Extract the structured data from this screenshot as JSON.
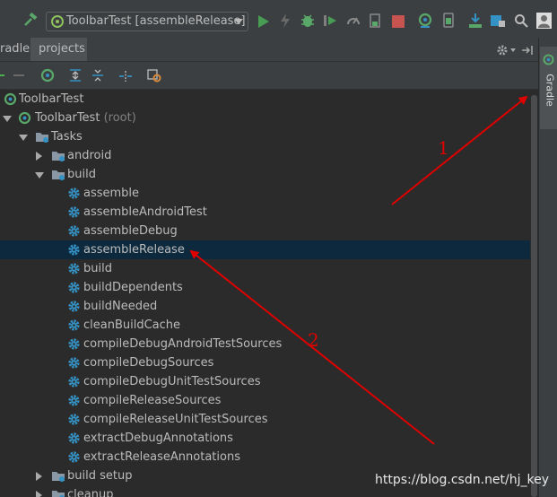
{
  "toolbar": {
    "run_config": "ToolbarTest [assembleRelease]",
    "icons": [
      "hammer-icon",
      "run-icon",
      "lightning-icon",
      "debug-icon",
      "coverage-icon",
      "profile-icon",
      "attach-icon",
      "stop-icon",
      "gradle-sync-icon",
      "avd-manager-icon",
      "sdk-manager-icon",
      "project-structure-icon",
      "search-icon",
      "avatar-icon"
    ]
  },
  "tabs": {
    "gradle": "radle",
    "projects": "projects"
  },
  "sidebar": {
    "gradle_label": "Gradle"
  },
  "tree": {
    "rows": [
      {
        "label": "ToolbarTest",
        "suffix": ""
      },
      {
        "label": "ToolbarTest",
        "suffix": "(root)"
      },
      {
        "label": "Tasks",
        "suffix": ""
      },
      {
        "label": "android",
        "suffix": ""
      },
      {
        "label": "build",
        "suffix": ""
      },
      {
        "label": "assemble",
        "suffix": ""
      },
      {
        "label": "assembleAndroidTest",
        "suffix": ""
      },
      {
        "label": "assembleDebug",
        "suffix": ""
      },
      {
        "label": "assembleRelease",
        "suffix": ""
      },
      {
        "label": "build",
        "suffix": ""
      },
      {
        "label": "buildDependents",
        "suffix": ""
      },
      {
        "label": "buildNeeded",
        "suffix": ""
      },
      {
        "label": "cleanBuildCache",
        "suffix": ""
      },
      {
        "label": "compileDebugAndroidTestSources",
        "suffix": ""
      },
      {
        "label": "compileDebugSources",
        "suffix": ""
      },
      {
        "label": "compileDebugUnitTestSources",
        "suffix": ""
      },
      {
        "label": "compileReleaseSources",
        "suffix": ""
      },
      {
        "label": "compileReleaseUnitTestSources",
        "suffix": ""
      },
      {
        "label": "extractDebugAnnotations",
        "suffix": ""
      },
      {
        "label": "extractReleaseAnnotations",
        "suffix": ""
      },
      {
        "label": "build setup",
        "suffix": ""
      },
      {
        "label": "cleanup",
        "suffix": ""
      }
    ],
    "selected": "assembleRelease"
  },
  "annotations": {
    "label_1": "1",
    "label_2": "2",
    "arrow_color": "#e00000"
  },
  "watermark": "https://blog.csdn.net/hj_key",
  "colors": {
    "selection": "#0d293e",
    "task_gear": "#3592c4",
    "gradle_green": "#4cae4f"
  }
}
